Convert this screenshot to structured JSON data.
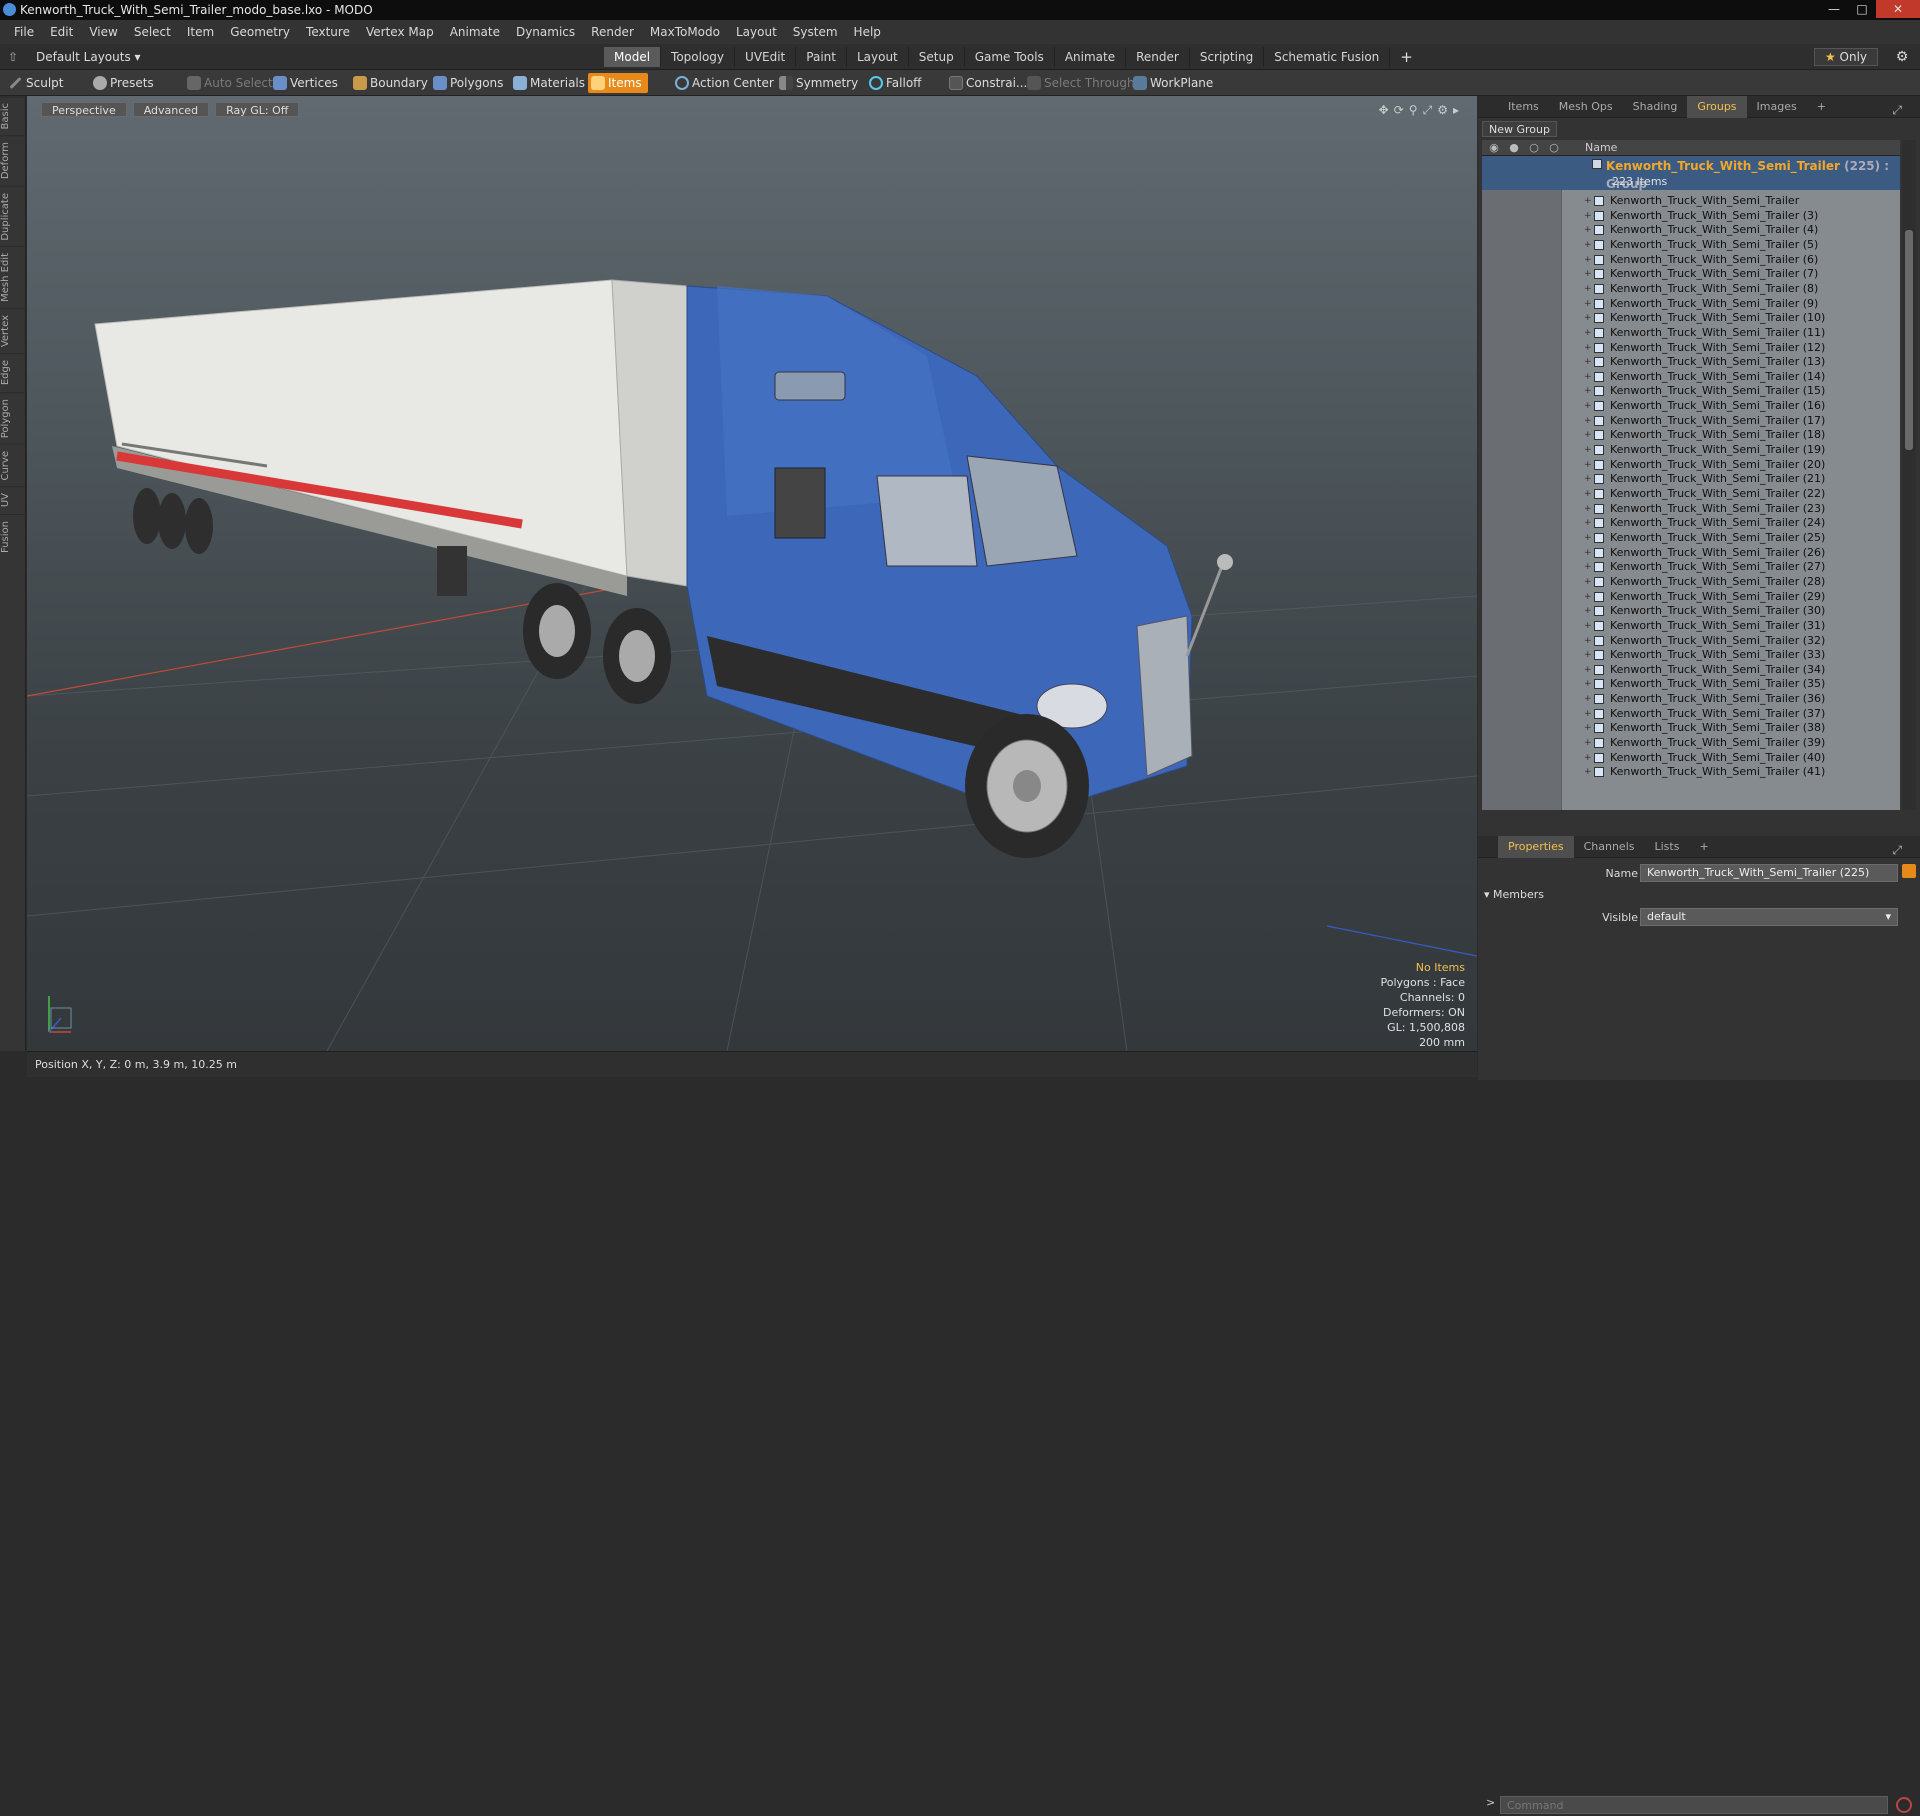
{
  "window": {
    "title": "Kenworth_Truck_With_Semi_Trailer_modo_base.lxo - MODO"
  },
  "menu": [
    "File",
    "Edit",
    "View",
    "Select",
    "Item",
    "Geometry",
    "Texture",
    "Vertex Map",
    "Animate",
    "Dynamics",
    "Render",
    "MaxToModo",
    "Layout",
    "System",
    "Help"
  ],
  "layout_selector": "Default Layouts",
  "mode_tabs": [
    {
      "label": "Model",
      "active": true
    },
    {
      "label": "Topology"
    },
    {
      "label": "UVEdit"
    },
    {
      "label": "Paint"
    },
    {
      "label": "Layout"
    },
    {
      "label": "Setup"
    },
    {
      "label": "Game Tools"
    },
    {
      "label": "Animate"
    },
    {
      "label": "Render"
    },
    {
      "label": "Scripting"
    },
    {
      "label": "Schematic Fusion"
    }
  ],
  "only_button": {
    "star": "★",
    "label": "Only"
  },
  "toolbar": {
    "sculpt": "Sculpt",
    "presets": "Presets",
    "auto_select": "Auto Select",
    "vertices": "Vertices",
    "boundary": "Boundary",
    "polygons": "Polygons",
    "materials": "Materials",
    "items": "Items",
    "action_center": "Action Center",
    "symmetry": "Symmetry",
    "falloff": "Falloff",
    "constraints": "Constrai...",
    "select_through": "Select Through",
    "workplane": "WorkPlane"
  },
  "left_tabs": [
    "Basic",
    "Deform",
    "Duplicate",
    "Mesh Edit",
    "Vertex",
    "Edge",
    "Polygon",
    "Curve",
    "UV",
    "Fusion"
  ],
  "viewport": {
    "view_mode": "Perspective",
    "shading": "Advanced",
    "raygl": "Ray GL: Off",
    "info": {
      "no_items": "No Items",
      "polygons": "Polygons : Face",
      "channels": "Channels: 0",
      "deformers": "Deformers: ON",
      "gl": "GL: 1,500,808",
      "scale": "200 mm"
    }
  },
  "status": {
    "position": "Position X, Y, Z:  0 m, 3.9 m, 10.25 m"
  },
  "right_panel": {
    "tabs": [
      {
        "label": "Items"
      },
      {
        "label": "Mesh Ops"
      },
      {
        "label": "Shading"
      },
      {
        "label": "Groups",
        "active": true
      },
      {
        "label": "Images"
      }
    ],
    "new_group": "New Group",
    "col_name": "Name",
    "group": {
      "name": "Kenworth_Truck_With_Semi_Trailer",
      "count": "(225) : Group",
      "sub": "223 Items"
    },
    "items": [
      "Kenworth_Truck_With_Semi_Trailer",
      "Kenworth_Truck_With_Semi_Trailer (3)",
      "Kenworth_Truck_With_Semi_Trailer (4)",
      "Kenworth_Truck_With_Semi_Trailer (5)",
      "Kenworth_Truck_With_Semi_Trailer (6)",
      "Kenworth_Truck_With_Semi_Trailer (7)",
      "Kenworth_Truck_With_Semi_Trailer (8)",
      "Kenworth_Truck_With_Semi_Trailer (9)",
      "Kenworth_Truck_With_Semi_Trailer (10)",
      "Kenworth_Truck_With_Semi_Trailer (11)",
      "Kenworth_Truck_With_Semi_Trailer (12)",
      "Kenworth_Truck_With_Semi_Trailer (13)",
      "Kenworth_Truck_With_Semi_Trailer (14)",
      "Kenworth_Truck_With_Semi_Trailer (15)",
      "Kenworth_Truck_With_Semi_Trailer (16)",
      "Kenworth_Truck_With_Semi_Trailer (17)",
      "Kenworth_Truck_With_Semi_Trailer (18)",
      "Kenworth_Truck_With_Semi_Trailer (19)",
      "Kenworth_Truck_With_Semi_Trailer (20)",
      "Kenworth_Truck_With_Semi_Trailer (21)",
      "Kenworth_Truck_With_Semi_Trailer (22)",
      "Kenworth_Truck_With_Semi_Trailer (23)",
      "Kenworth_Truck_With_Semi_Trailer (24)",
      "Kenworth_Truck_With_Semi_Trailer (25)",
      "Kenworth_Truck_With_Semi_Trailer (26)",
      "Kenworth_Truck_With_Semi_Trailer (27)",
      "Kenworth_Truck_With_Semi_Trailer (28)",
      "Kenworth_Truck_With_Semi_Trailer (29)",
      "Kenworth_Truck_With_Semi_Trailer (30)",
      "Kenworth_Truck_With_Semi_Trailer (31)",
      "Kenworth_Truck_With_Semi_Trailer (32)",
      "Kenworth_Truck_With_Semi_Trailer (33)",
      "Kenworth_Truck_With_Semi_Trailer (34)",
      "Kenworth_Truck_With_Semi_Trailer (35)",
      "Kenworth_Truck_With_Semi_Trailer (36)",
      "Kenworth_Truck_With_Semi_Trailer (37)",
      "Kenworth_Truck_With_Semi_Trailer (38)",
      "Kenworth_Truck_With_Semi_Trailer (39)",
      "Kenworth_Truck_With_Semi_Trailer (40)",
      "Kenworth_Truck_With_Semi_Trailer (41)"
    ],
    "props_tabs": [
      {
        "label": "Properties",
        "active": true
      },
      {
        "label": "Channels"
      },
      {
        "label": "Lists"
      }
    ],
    "props": {
      "name_label": "Name",
      "name_value": "Kenworth_Truck_With_Semi_Trailer (225)",
      "members": "Members",
      "visible_label": "Visible",
      "visible_value": "default"
    },
    "command_placeholder": "Command"
  },
  "colors": {
    "accent": "#e88a1a",
    "highlight_text": "#f2c14e",
    "truck_blue": "#3d67b8"
  }
}
